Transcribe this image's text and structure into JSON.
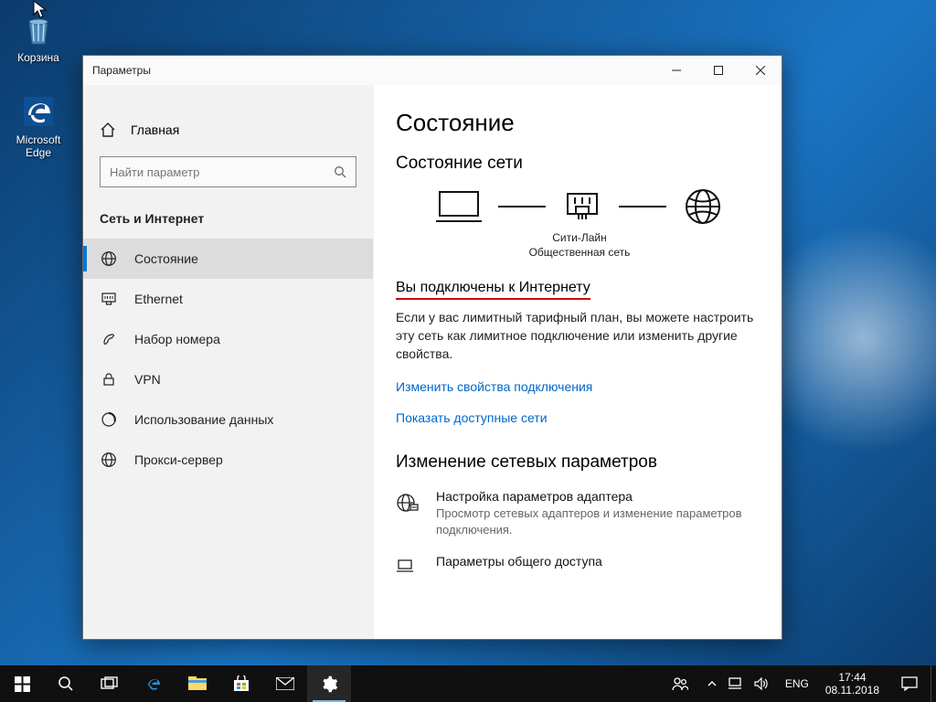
{
  "desktop": {
    "recycle_bin": "Корзина",
    "edge": "Microsoft Edge"
  },
  "window": {
    "title": "Параметры",
    "home": "Главная",
    "search_placeholder": "Найти параметр",
    "category": "Сеть и Интернет",
    "nav": {
      "status": "Состояние",
      "ethernet": "Ethernet",
      "dialup": "Набор номера",
      "vpn": "VPN",
      "data_usage": "Использование данных",
      "proxy": "Прокси-сервер"
    }
  },
  "content": {
    "heading": "Состояние",
    "subheading": "Состояние сети",
    "net_name": "Сити-Лайн",
    "net_type": "Общественная сеть",
    "connected_title": "Вы подключены к Интернету",
    "connected_body": "Если у вас лимитный тарифный план, вы можете настроить эту сеть как лимитное подключение или изменить другие свойства.",
    "link_change": "Изменить свойства подключения",
    "link_show": "Показать доступные сети",
    "section3_title": "Изменение сетевых параметров",
    "adapter_title": "Настройка параметров адаптера",
    "adapter_desc": "Просмотр сетевых адаптеров и изменение параметров подключения.",
    "sharing_title": "Параметры общего доступа"
  },
  "taskbar": {
    "lang": "ENG",
    "time": "17:44",
    "date": "08.11.2018"
  }
}
